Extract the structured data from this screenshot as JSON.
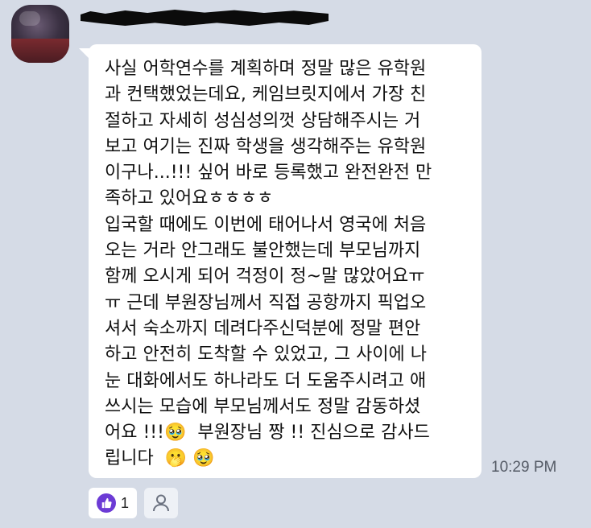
{
  "sender": {
    "avatar_icon": "avatar-photo",
    "name_redacted": true
  },
  "message": {
    "lines": [
      "사실 어학연수를 계획하며 정말 많은 유학원",
      "과 컨택했었는데요, 케임브릿지에서 가장 친",
      "절하고 자세히 성심성의껏 상담해주시는 거",
      "보고 여기는 진짜 학생을 생각해주는 유학원",
      "이구나...!!! 싶어 바로 등록했고 완전완전 만",
      "족하고 있어요ㅎㅎㅎㅎ",
      "입국할 때에도 이번에 태어나서 영국에 처음",
      "오는 거라 안그래도 불안했는데 부모님까지",
      "함께 오시게 되어 걱정이 정~말 많았어요ㅠ",
      "ㅠ 근데 부원장님께서 직접 공항까지 픽업오",
      "셔서 숙소까지 데려다주신덕분에 정말 편안",
      "하고 안전히 도착할 수 있었고, 그 사이에 나",
      "눈 대화에서도 하나라도 더 도움주시려고 애",
      "쓰시는 모습에 부모님께서도 정말 감동하셨"
    ],
    "line14_text": "어요 !!!",
    "line14_emoji": "🥹",
    "line14_rest": "  부원장님 짱 !! 진심으로 감사드",
    "line15_text": "립니다 ",
    "line15_emoji_1": "🫢",
    "line15_emoji_2": "🥹",
    "timestamp": "10:29 PM"
  },
  "reactions": {
    "like_icon": "thumbs-up-icon",
    "like_color": "#6c3bd5",
    "like_count": "1",
    "add_reaction_icon": "person-icon"
  }
}
